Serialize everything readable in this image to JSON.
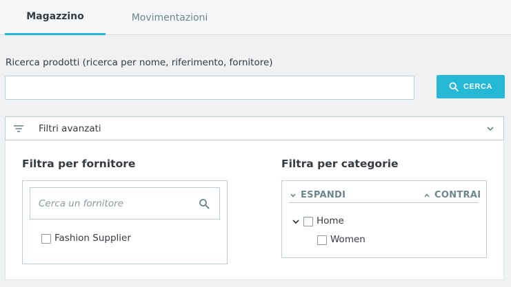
{
  "tabs": [
    {
      "label": "Magazzino",
      "active": true
    },
    {
      "label": "Movimentazioni",
      "active": false
    }
  ],
  "search": {
    "label": "Ricerca prodotti (ricerca per nome, riferimento, fornitore)",
    "value": "",
    "button_label": "CERCA",
    "button_icon": "search-icon"
  },
  "advanced_filters": {
    "label": "Filtri avanzati",
    "icon": "filter-icon",
    "expanded": true
  },
  "supplier_filter": {
    "title": "Filtra per fornitore",
    "search_placeholder": "Cerca un fornitore",
    "items": [
      {
        "label": "Fashion Supplier",
        "checked": false
      }
    ]
  },
  "category_filter": {
    "title": "Filtra per categorie",
    "expand_label": "ESPANDI",
    "collapse_label": "CONTRAI",
    "tree": [
      {
        "label": "Home",
        "checked": false,
        "expanded": true,
        "children": [
          {
            "label": "Women",
            "checked": false
          }
        ]
      }
    ]
  },
  "colors": {
    "accent": "#25b9d7",
    "background": "#eff1f2",
    "border": "#bbcdd2",
    "text": "#363a41",
    "muted": "#6c868e"
  }
}
